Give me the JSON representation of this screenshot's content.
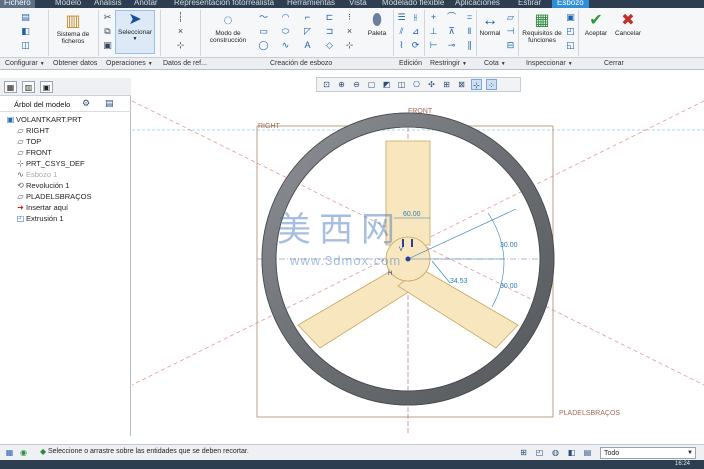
{
  "tabs": [
    "Fichero",
    "Modelo",
    "Análisis",
    "Anotar",
    "Representación fotorrealista",
    "Herramientas",
    "Vista",
    "Modelado flexible",
    "Aplicaciones",
    "Estirar",
    "Esbozo"
  ],
  "ribbon": {
    "sistema_ficheros": "Sistema de ficheros",
    "seleccionar": "Seleccionar",
    "modo_construccion": "Modo de construcción",
    "paleta": "Paleta",
    "normal": "Normal",
    "requisitos": "Requisitos de funciones",
    "aceptar": "Aceptar",
    "cancelar": "Cancelar"
  },
  "groups": [
    "Configurar",
    "Obtener datos",
    "Operaciones",
    "Datos de ref...",
    "Creación de esbozo",
    "Edición",
    "Restringir",
    "Cota",
    "Inspeccionar",
    "Cerrar"
  ],
  "tree": {
    "title": "Árbol del modelo",
    "items": [
      "VOLANTKART.PRT",
      "RIGHT",
      "TOP",
      "FRONT",
      "PRT_CSYS_DEF",
      "Esbozo 1",
      "Revolución 1",
      "PLADELSBRAÇOS",
      "Insertar aquí",
      "Extrusión 1"
    ]
  },
  "sketch": {
    "label_front": "FRONT",
    "label_right": "RIGHT",
    "label_plane": "PLADELSBRAÇOS",
    "dim_top": "60.00",
    "dim_angle_1": "30.00",
    "dim_angle_2": "30.00",
    "dim_small": "34.53",
    "label_h": "H",
    "label_v": "V"
  },
  "watermark": {
    "cn": "美西网",
    "url": "www.3dmox.com"
  },
  "status": {
    "message": "Seleccione o arrastre sobre las entidades que se deben recortar.",
    "filter": "Todo",
    "clock": "16:24"
  },
  "colors": {
    "accent": "#2e8fd6",
    "fill": "#f8e7be",
    "ring": "#75787c",
    "dim": "#2f7db5"
  }
}
